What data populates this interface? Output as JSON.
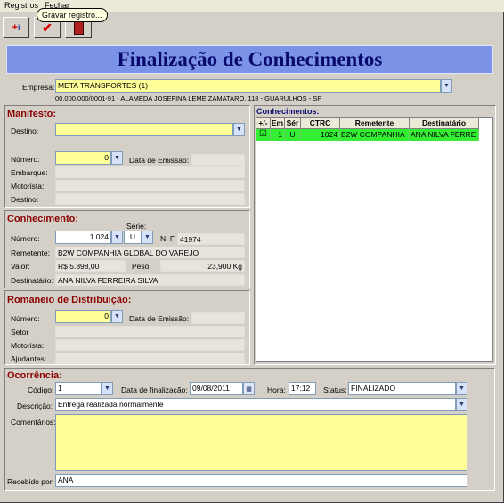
{
  "menu": {
    "registros": "Registros",
    "fechar": "Fechar"
  },
  "toolbar": {
    "tooltip": "Gravar registro..."
  },
  "title": "Finalização de Conhecimentos",
  "empresa": {
    "label": "Empresa:",
    "value": "META TRANSPORTES (1)",
    "address": "00.000.000/0001-91 - ALAMEDA JOSEFINA LEME ZAMATARO, 118 - GUARULHOS - SP"
  },
  "manifesto": {
    "title": "Manifesto:",
    "destino_label": "Destino:",
    "destino_value": "",
    "numero_label": "Número:",
    "numero_value": "0",
    "data_emissao_label": "Data de Emissão:",
    "data_emissao_value": "",
    "embarque_label": "Embarque:",
    "motorista_label": "Motorista:",
    "destino2_label": "Destino:"
  },
  "conhecimento": {
    "title": "Conhecimento:",
    "numero_label": "Número:",
    "numero_value": "1.024",
    "serie_label": "Série:",
    "serie_value": "U",
    "nf_label": "N. F.",
    "nf_value": "41974",
    "remetente_label": "Remetente:",
    "remetente_value": "B2W COMPANHIA GLOBAL DO VAREJO",
    "valor_label": "Valor:",
    "valor_value": "R$ 5.898,00",
    "peso_label": "Peso:",
    "peso_value": "23,900 Kg",
    "destinatario_label": "Destinatário:",
    "destinatario_value": "ANA NILVA FERREIRA SILVA"
  },
  "romaneio": {
    "title": "Romaneio de Distribuição:",
    "numero_label": "Número:",
    "numero_value": "0",
    "data_emissao_label": "Data de Emissão:",
    "setor_label": "Setor",
    "motorista_label": "Motorista:",
    "ajudantes_label": "Ajudantes:"
  },
  "conhecimentos_grid": {
    "title": "Conhecimentos:",
    "headers": [
      "+/-",
      "Em",
      "Sér",
      "CTRC",
      "Remetente",
      "Destinatário"
    ],
    "rows": [
      {
        "checked": "☑",
        "em": "1",
        "ser": "U",
        "ctrc": "1024",
        "remetente": "B2W COMPANHIA",
        "destinatario": "ANA NILVA FERRE"
      }
    ]
  },
  "ocorrencia": {
    "title": "Ocorrência:",
    "codigo_label": "Código:",
    "codigo_value": "1",
    "data_label": "Data de finalização:",
    "data_value": "09/08/2011",
    "hora_label": "Hora:",
    "hora_value": "17:12",
    "status_label": "Status:",
    "status_value": "FINALIZADO",
    "descricao_label": "Descrição:",
    "descricao_value": "Entrega realizada normalmente",
    "comentarios_label": "Comentários:",
    "comentarios_value": "",
    "recebido_label": "Recebido por:",
    "recebido_value": "ANA"
  },
  "colors": {
    "title_bg": "#7a93e6",
    "title_text": "#0a0a6e",
    "section_label": "#8b0000",
    "field_yellow": "#ffff99",
    "row_green": "#33ee33"
  }
}
